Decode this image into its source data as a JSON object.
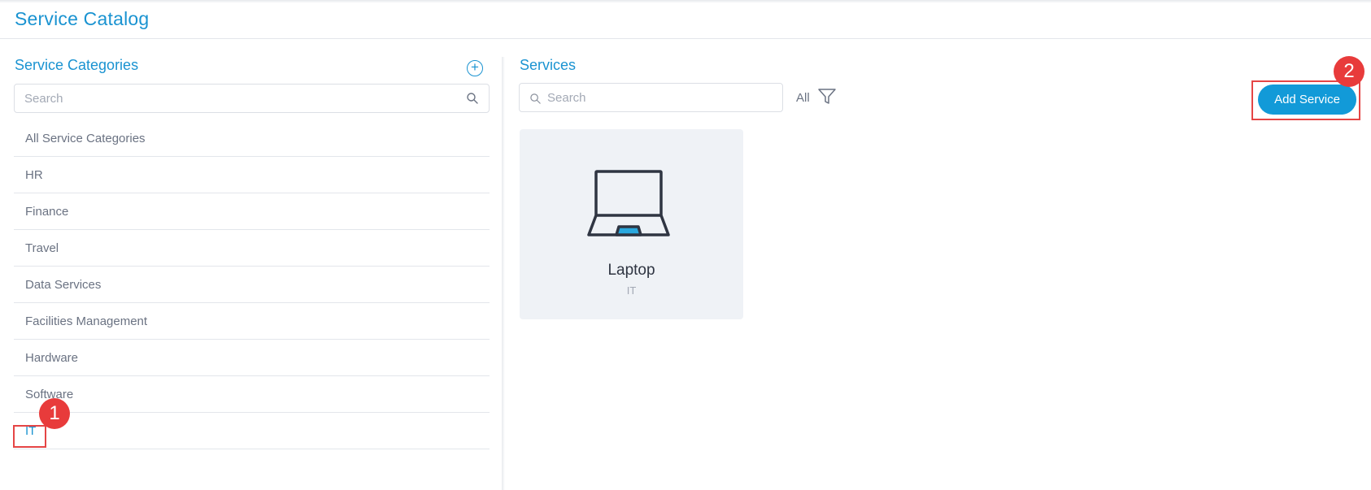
{
  "page": {
    "title": "Service Catalog"
  },
  "categories_panel": {
    "title": "Service Categories",
    "search_placeholder": "Search",
    "items": [
      {
        "label": "All Service Categories"
      },
      {
        "label": "HR"
      },
      {
        "label": "Finance"
      },
      {
        "label": "Travel"
      },
      {
        "label": "Data Services"
      },
      {
        "label": "Facilities Management"
      },
      {
        "label": "Hardware"
      },
      {
        "label": "Software"
      },
      {
        "label": "IT",
        "active": true
      }
    ]
  },
  "services_panel": {
    "title": "Services",
    "search_placeholder": "Search",
    "filter_label": "All",
    "add_label": "Add Service",
    "cards": [
      {
        "name": "Laptop",
        "category": "IT",
        "icon": "laptop-icon"
      }
    ]
  },
  "annotations": {
    "badge_1": "1",
    "badge_2": "2"
  },
  "colors": {
    "accent": "#1a93d1",
    "button": "#129ad8",
    "highlight": "#e54545",
    "badge": "#e83b3b",
    "card_bg": "#eff2f6"
  }
}
